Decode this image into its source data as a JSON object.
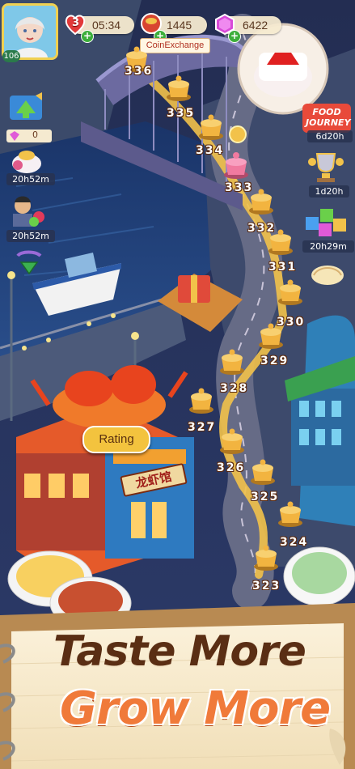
{
  "hud": {
    "avatar_level": "106",
    "hearts": "3",
    "timer": "05:34",
    "coins": "1445",
    "coin_exchange_label": "CoinExchange",
    "gems": "6422"
  },
  "side_panel": {
    "gift_count": "0",
    "timers": [
      "20h52m",
      "20h52m"
    ]
  },
  "right_panel": {
    "food_journey_logo": "FOOD JOURNEY",
    "timers": [
      "6d20h",
      "1d20h",
      "20h29m"
    ]
  },
  "levels": [
    "336",
    "335",
    "334",
    "333",
    "332",
    "331",
    "330",
    "329",
    "328",
    "327",
    "326",
    "325",
    "324",
    "323"
  ],
  "map": {
    "rating_button": "Rating",
    "shop_sign": "龙虾馆"
  },
  "tagline": {
    "line1": "Taste More",
    "line2": "Grow More"
  },
  "colors": {
    "accent": "#f07a3a",
    "title": "#5a2e14",
    "water": "#1d3c77",
    "road": "#6a6f88",
    "pot": "#f2b440"
  }
}
